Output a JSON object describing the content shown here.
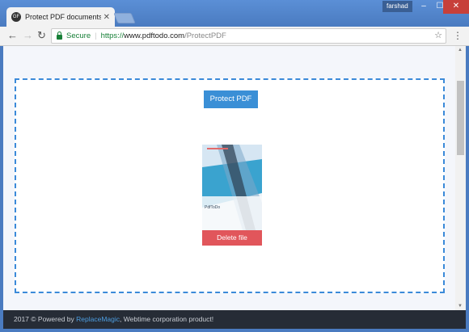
{
  "browser": {
    "tab_title": "Protect PDF documents f",
    "favicon_text": "GF",
    "user_name": "farshad",
    "secure_label": "Secure",
    "url_scheme": "https://",
    "url_host": "www.pdftodo.com",
    "url_path": "/ProtectPDF"
  },
  "page": {
    "protect_button": "Protect PDF",
    "delete_button": "Delete file",
    "thumbnail_caption": "PdfToDo"
  },
  "footer": {
    "prefix": "2017 © Powered by ",
    "link": "ReplaceMagic",
    "suffix": ", Webtime corporation product!"
  },
  "colors": {
    "accent": "#3a8fd6",
    "delete": "#e1565b",
    "footer_bg": "#262c36",
    "secure": "#188038"
  }
}
